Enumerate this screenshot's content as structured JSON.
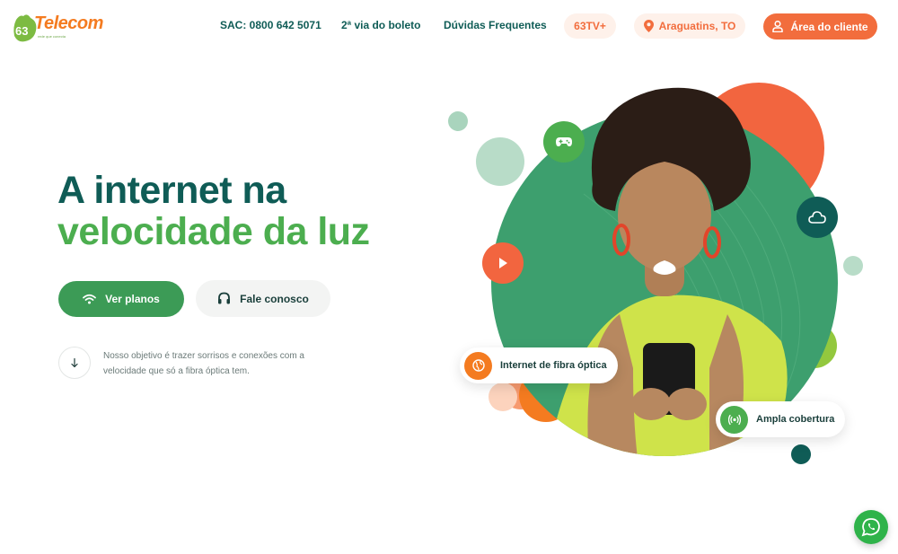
{
  "header": {
    "logo_text": "Telecom",
    "logo_tagline": "rede que conecta",
    "nav": {
      "sac": "SAC: 0800 642 5071",
      "boleto": "2ª via do boleto",
      "faq": "Dúvidas Frequentes"
    },
    "tv_label": "63TV+",
    "location": "Araguatins, TO",
    "client_area": "Área do cliente"
  },
  "hero": {
    "title_line1": "A internet na",
    "title_line2": "velocidade da luz",
    "btn_plans": "Ver planos",
    "btn_contact": "Fale conosco",
    "tagline": "Nosso objetivo é trazer sorrisos e conexões com a velocidade que só a fibra óptica tem."
  },
  "art": {
    "chip_fiber": "Internet de fibra óptica",
    "chip_coverage": "Ampla cobertura"
  },
  "colors": {
    "brand_green_dark": "#0f5c56",
    "brand_green": "#4cae4f",
    "brand_orange": "#f26d3d",
    "whatsapp": "#2fb34a"
  }
}
